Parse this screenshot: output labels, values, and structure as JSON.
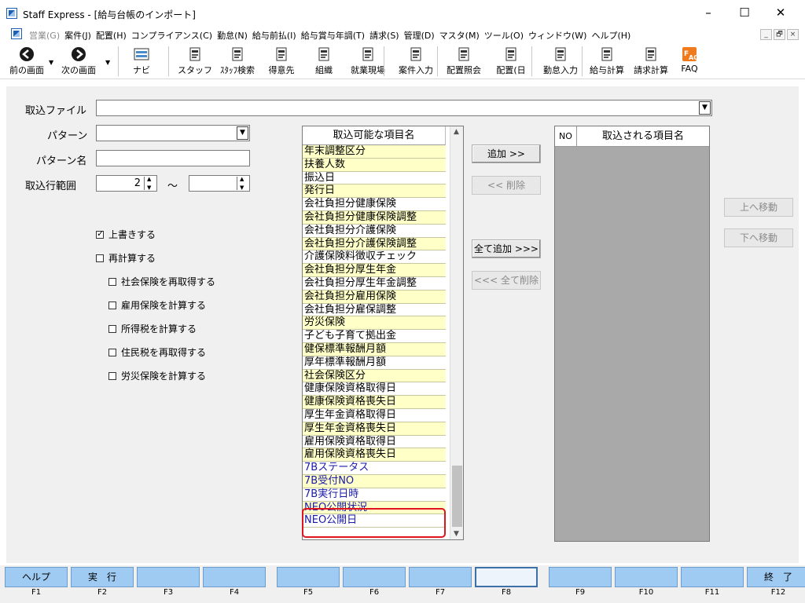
{
  "window": {
    "title": "Staff Express - [給与台帳のインポート]",
    "controls": {
      "minimize": "–",
      "maximize": "☐",
      "close": "✕"
    }
  },
  "menu": {
    "items": [
      {
        "label": "営業(G)",
        "disabled": true
      },
      {
        "label": "案件(J)"
      },
      {
        "label": "配置(H)"
      },
      {
        "label": "コンプライアンス(C)"
      },
      {
        "label": "勤怠(N)"
      },
      {
        "label": "給与前払(I)"
      },
      {
        "label": "給与賞与年調(T)"
      },
      {
        "label": "請求(S)"
      },
      {
        "label": "管理(D)"
      },
      {
        "label": "マスタ(M)"
      },
      {
        "label": "ツール(O)"
      },
      {
        "label": "ウィンドウ(W)"
      },
      {
        "label": "ヘルプ(H)"
      }
    ],
    "mdi_controls": [
      "_",
      "🗗",
      "×"
    ]
  },
  "toolbar": {
    "buttons": [
      {
        "label": "前の画面",
        "icon": "back-arrow-icon"
      },
      {
        "label": "次の画面",
        "icon": "forward-arrow-icon"
      },
      {
        "label": "ナビ",
        "icon": "keyboard-icon"
      },
      {
        "label": "スタッフ",
        "icon": "staff-icon"
      },
      {
        "label": "ｽﾀｯﾌ検索",
        "icon": "staff-search-icon"
      },
      {
        "label": "得意先",
        "icon": "customer-icon"
      },
      {
        "label": "組織",
        "icon": "organization-icon"
      },
      {
        "label": "就業現場",
        "icon": "workplace-icon"
      },
      {
        "label": "案件入力",
        "icon": "job-entry-icon"
      },
      {
        "label": "配置照会",
        "icon": "placement-inquiry-icon"
      },
      {
        "label": "配置(日",
        "icon": "placement-daily-icon"
      },
      {
        "label": "勤怠入力",
        "icon": "attendance-entry-icon"
      },
      {
        "label": "給与計算",
        "icon": "payroll-calc-icon"
      },
      {
        "label": "請求計算",
        "icon": "billing-calc-icon"
      },
      {
        "label": "FAQ",
        "icon": "faq-icon"
      }
    ]
  },
  "form": {
    "import_file_label": "取込ファイル",
    "import_file_value": "",
    "pattern_label": "パターン",
    "pattern_value": "",
    "pattern_name_label": "パターン名",
    "pattern_name_value": "",
    "range_label": "取込行範囲",
    "range_from": "2",
    "range_tilde": "～",
    "range_to": ""
  },
  "options": [
    {
      "label": "上書きする",
      "checked": true
    },
    {
      "label": "再計算する",
      "checked": false
    },
    {
      "label": "社会保険を再取得する",
      "checked": false
    },
    {
      "label": "雇用保険を計算する",
      "checked": false
    },
    {
      "label": "所得税を計算する",
      "checked": false
    },
    {
      "label": "住民税を再取得する",
      "checked": false
    },
    {
      "label": "労災保険を計算する",
      "checked": false
    }
  ],
  "source_list": {
    "header": "取込可能な項目名",
    "items": [
      "年末調整区分",
      "扶養人数",
      "振込日",
      "発行日",
      "会社負担分健康保険",
      "会社負担分健康保険調整",
      "会社負担分介護保険",
      "会社負担分介護保険調整",
      "介護保険料徴収チェック",
      "会社負担分厚生年金",
      "会社負担分厚生年金調整",
      "会社負担分雇用保険",
      "会社負担分雇保調整",
      "労災保険",
      "子ども子育て拠出金",
      "健保標準報酬月額",
      "厚年標準報酬月額",
      "社会保険区分",
      "健康保険資格取得日",
      "健康保険資格喪失日",
      "厚生年金資格取得日",
      "厚生年金資格喪失日",
      "雇用保険資格取得日",
      "雇用保険資格喪失日",
      "7Bステータス",
      "7B受付NO",
      "7B実行日時",
      "NEO公開状況",
      "NEO公開日"
    ],
    "blue_from_index": 24
  },
  "dest_list": {
    "header_no": "NO",
    "header_name": "取込される項目名"
  },
  "actions": {
    "add": "追加 >>",
    "remove": "<< 削除",
    "add_all": "全て追加 >>>",
    "remove_all": "<<< 全て削除",
    "move_up": "上へ移動",
    "move_down": "下へ移動"
  },
  "function_keys": [
    {
      "key": "F1",
      "label": "ヘルプ"
    },
    {
      "key": "F2",
      "label": "実　行"
    },
    {
      "key": "F3",
      "label": ""
    },
    {
      "key": "F4",
      "label": ""
    },
    {
      "key": "F5",
      "label": ""
    },
    {
      "key": "F6",
      "label": ""
    },
    {
      "key": "F7",
      "label": ""
    },
    {
      "key": "F8",
      "label": "",
      "active": true
    },
    {
      "key": "F9",
      "label": ""
    },
    {
      "key": "F10",
      "label": ""
    },
    {
      "key": "F11",
      "label": ""
    },
    {
      "key": "F12",
      "label": "終　了"
    }
  ],
  "colors": {
    "row_even": "#ffffc8",
    "row_odd": "#ffffff",
    "blue_text": "#1a1aa8",
    "highlight": "#e0141e",
    "fkey": "#9fcbf2",
    "dest_bg": "#a9a9a9"
  }
}
